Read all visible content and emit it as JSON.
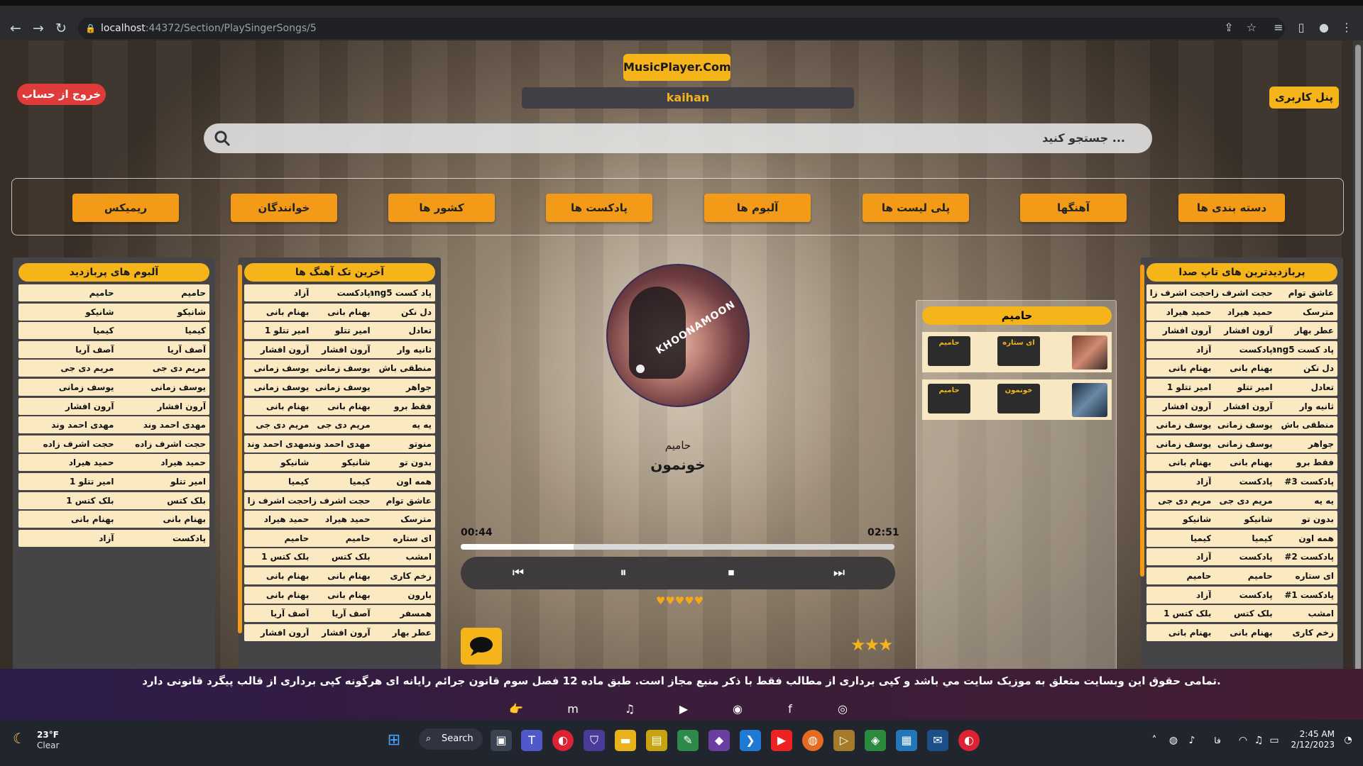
{
  "browser": {
    "url_host": "localhost",
    "url_path": ":44372/Section/PlaySingerSongs/5"
  },
  "header": {
    "logo": "MusicPlayer.Com",
    "username": "kaihan",
    "logout": "خروج از حساب",
    "panel": "پنل کاربری",
    "search_placeholder": "جستجو کنید ..."
  },
  "categories": [
    "دسته بندی ها",
    "آهنگها",
    "پلی لیست ها",
    "آلبوم ها",
    "پادکست ها",
    "کشور ها",
    "خوانندگان",
    "ریمیکس"
  ],
  "albums": {
    "title": "آلبوم های پربازدید",
    "rows": [
      [
        "حامیم",
        "حامیم"
      ],
      [
        "شانیکو",
        "شانیکو"
      ],
      [
        "کیمیا",
        "کیمیا"
      ],
      [
        "آصف آریا",
        "آصف آریا"
      ],
      [
        "مریم دی جی",
        "مریم دی جی"
      ],
      [
        "یوسف زمانی",
        "یوسف زمانی"
      ],
      [
        "آرون افشار",
        "آرون افشار"
      ],
      [
        "مهدی احمد وند",
        "مهدی احمد وند"
      ],
      [
        "حجت اشرف زاده",
        "حجت اشرف زاده"
      ],
      [
        "حمید هیراد",
        "حمید هیراد"
      ],
      [
        "امیر تتلو",
        "امیر تتلو 1"
      ],
      [
        "بلک کتس",
        "بلک کتس 1"
      ],
      [
        "بهنام بانی",
        "بهنام بانی"
      ],
      [
        "پادکست",
        "آزاد"
      ]
    ]
  },
  "latest": {
    "title": "آخرین تک آهنگ ها",
    "rows": [
      [
        "پاد کست Rang5",
        "پادکست",
        "آزاد"
      ],
      [
        "دل نکن",
        "بهنام بانی",
        "بهنام بانی"
      ],
      [
        "تعادل",
        "امیر تتلو",
        "امیر تتلو 1"
      ],
      [
        "ثانیه وار",
        "آرون افشار",
        "آرون افشار"
      ],
      [
        "منطقی باش",
        "یوسف زمانی",
        "یوسف زمانی"
      ],
      [
        "جواهر",
        "یوسف زمانی",
        "یوسف زمانی"
      ],
      [
        "فقط برو",
        "بهنام بانی",
        "بهنام بانی"
      ],
      [
        "یه یه",
        "مریم دی جی",
        "مریم دی جی"
      ],
      [
        "منوتو",
        "مهدی احمد وند",
        "مهدی احمد وند"
      ],
      [
        "بدون تو",
        "شانیکو",
        "شانیکو"
      ],
      [
        "همه اون",
        "کیمیا",
        "کیمیا"
      ],
      [
        "عاشق توام",
        "حجت اشرف زاده",
        "حجت اشرف زاده"
      ],
      [
        "مترسک",
        "حمید هیراد",
        "حمید هیراد"
      ],
      [
        "ای ستاره",
        "حامیم",
        "حامیم"
      ],
      [
        "امشب",
        "بلک کتس",
        "بلک کتس 1"
      ],
      [
        "زخم کاری",
        "بهنام بانی",
        "بهنام بانی"
      ],
      [
        "بارون",
        "بهنام بانی",
        "بهنام بانی"
      ],
      [
        "همسفر",
        "آصف آریا",
        "آصف آریا"
      ],
      [
        "عطر بهار",
        "آرون افشار",
        "آرون افشار"
      ]
    ]
  },
  "top": {
    "title": "پربازدیدترین های تاپ صدا",
    "rows": [
      [
        "عاشق توام",
        "حجت اشرف زاده",
        "حجت اشرف زاده"
      ],
      [
        "مترسک",
        "حمید هیراد",
        "حمید هیراد"
      ],
      [
        "عطر بهار",
        "آرون افشار",
        "آرون افشار"
      ],
      [
        "پاد کست Rang5",
        "پادکست",
        "آزاد"
      ],
      [
        "دل نکن",
        "بهنام بانی",
        "بهنام بانی"
      ],
      [
        "تعادل",
        "امیر تتلو",
        "امیر تتلو 1"
      ],
      [
        "ثانیه وار",
        "آرون افشار",
        "آرون افشار"
      ],
      [
        "منطقی باش",
        "یوسف زمانی",
        "یوسف زمانی"
      ],
      [
        "جواهر",
        "یوسف زمانی",
        "یوسف زمانی"
      ],
      [
        "فقط برو",
        "بهنام بانی",
        "بهنام بانی"
      ],
      [
        "پادکست 3#",
        "پادکست",
        "آزاد"
      ],
      [
        "یه یه",
        "مریم دی جی",
        "مریم دی جی"
      ],
      [
        "بدون تو",
        "شانیکو",
        "شانیکو"
      ],
      [
        "همه اون",
        "کیمیا",
        "کیمیا"
      ],
      [
        "پادکست 2#",
        "پادکست",
        "آزاد"
      ],
      [
        "ای ستاره",
        "حامیم",
        "حامیم"
      ],
      [
        "پادکست 1#",
        "پادکست",
        "آزاد"
      ],
      [
        "امشب",
        "بلک کتس",
        "بلک کتس 1"
      ],
      [
        "زخم کاری",
        "بهنام بانی",
        "بهنام بانی"
      ]
    ]
  },
  "player": {
    "cover_text": "KHOONAMOON",
    "artist": "حامیم",
    "song": "خونمون",
    "current": "00:44",
    "total": "02:51",
    "progress": 0.26,
    "rating": 3
  },
  "playlist": {
    "title": "حامیم",
    "items": [
      {
        "artist": "حامیم",
        "song": "ای ستاره"
      },
      {
        "artist": "حامیم",
        "song": "خونمون"
      }
    ]
  },
  "footer": {
    "copyright": "تمامی حقوق این وبسایت متعلق به موزیک سایت مي باشد و کپی برداری از مطالب فقط با ذکر منبع مجاز است. طبق ماده 12 فصل سوم قانون جرائم رایانه ای هرگونه کپی برداری از قالب پیگرد قانونی دارد."
  },
  "taskbar": {
    "weather_temp": "23°F",
    "weather_desc": "Clear",
    "search": "Search",
    "time": "2:45 AM",
    "date": "2/12/2023",
    "lang": "فا"
  },
  "colors": {
    "accent": "#f5b41a",
    "nav": "#f39a18",
    "logout": "#e03b3b"
  }
}
